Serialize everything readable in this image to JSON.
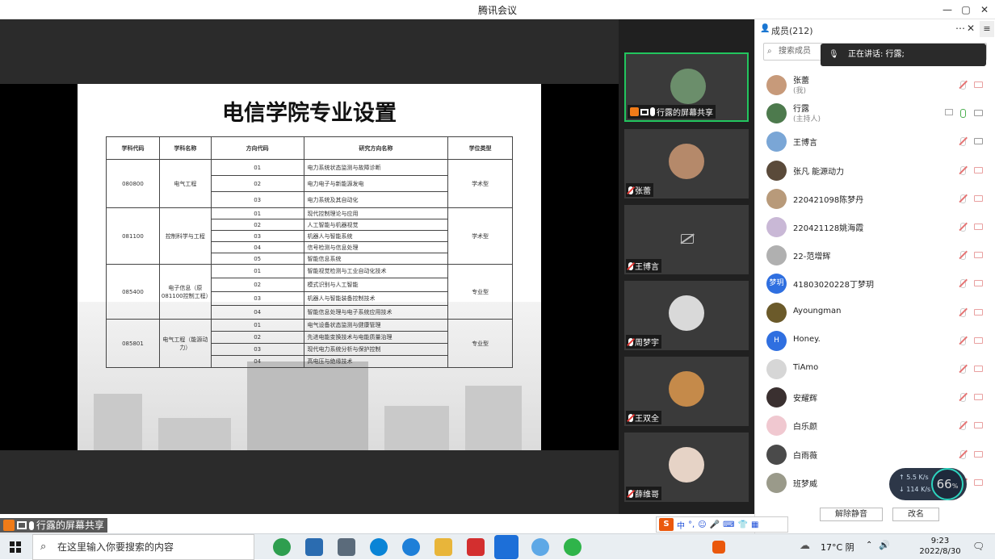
{
  "window": {
    "title": "腾讯会议"
  },
  "slide": {
    "title": "电信学院专业设置",
    "headers": [
      "学科代码",
      "学科名称",
      "方向代码",
      "研究方向名称",
      "学位类型"
    ],
    "groups": [
      {
        "code": "080800",
        "name": "电气工程",
        "degree": "学术型",
        "rows": [
          [
            "01",
            "电力系统状态监测与故障诊断"
          ],
          [
            "02",
            "电力电子与新能源发电"
          ],
          [
            "03",
            "电力系统及其自动化"
          ]
        ]
      },
      {
        "code": "081100",
        "name": "控制科学与工程",
        "degree": "学术型",
        "rows": [
          [
            "01",
            "现代控制理论与应用"
          ],
          [
            "02",
            "人工智能与机器视觉"
          ],
          [
            "03",
            "机器人与智能系统"
          ],
          [
            "04",
            "信号检测与信息处理"
          ],
          [
            "05",
            "智能信息系统"
          ]
        ]
      },
      {
        "code": "085400",
        "name": "电子信息（原081100控制工程）",
        "degree": "专业型",
        "rows": [
          [
            "01",
            "智能视觉检测与工业自动化技术"
          ],
          [
            "02",
            "模式识别与人工智能"
          ],
          [
            "03",
            "机器人与智能装备控制技术"
          ],
          [
            "04",
            "智能信息处理与电子系统应用技术"
          ]
        ]
      },
      {
        "code": "085801",
        "name": "电气工程（能源动力）",
        "degree": "专业型",
        "rows": [
          [
            "01",
            "电气设备状态监测与健康管理"
          ],
          [
            "02",
            "先进电能变换技术与电能质量治理"
          ],
          [
            "03",
            "现代电力系统分析与保护控制"
          ],
          [
            "04",
            "高电压与绝缘技术"
          ]
        ]
      }
    ]
  },
  "share_label": "行露的屏幕共享",
  "video_tiles": [
    {
      "label": "行露的屏幕共享",
      "color": "#6b8e6b"
    },
    {
      "label": "张蕾",
      "color": "#b5896a"
    },
    {
      "label": "王博言",
      "color": ""
    },
    {
      "label": "周梦宇",
      "color": "#d9d9d9"
    },
    {
      "label": "王双全",
      "color": "#c58a4a"
    },
    {
      "label": "薛维哥",
      "color": "#e6d3c6"
    }
  ],
  "panel": {
    "members_count": "成员(212)",
    "search_placeholder": "搜索成员",
    "speaking": "正在讲话: 行露;",
    "members": [
      {
        "name": "张蕾",
        "sub": "(我)",
        "color": "#c79a7a",
        "initial": ""
      },
      {
        "name": "行露",
        "sub": "(主持人)",
        "color": "#4d7a4d",
        "initial": ""
      },
      {
        "name": "王博言",
        "sub": "",
        "color": "#7aa6d6",
        "initial": ""
      },
      {
        "name": "张凡 能源动力",
        "sub": "",
        "color": "#5a4a3a",
        "initial": ""
      },
      {
        "name": "220421098陈梦丹",
        "sub": "",
        "color": "#b89a7a",
        "initial": ""
      },
      {
        "name": "220421128姚海霞",
        "sub": "",
        "color": "#c9b8d6",
        "initial": ""
      },
      {
        "name": "22-范增辉",
        "sub": "",
        "color": "#b0b0b0",
        "initial": ""
      },
      {
        "name": "41803020228丁梦玥",
        "sub": "",
        "color": "#2f6fe0",
        "initial": "梦玥"
      },
      {
        "name": "Ayoungman",
        "sub": "",
        "color": "#6b5a2a",
        "initial": ""
      },
      {
        "name": "Honey.",
        "sub": "",
        "color": "#2f6fe0",
        "initial": "H"
      },
      {
        "name": "TiAmo",
        "sub": "",
        "color": "#d6d6d6",
        "initial": ""
      },
      {
        "name": "安耀辉",
        "sub": "",
        "color": "#3a3030",
        "initial": ""
      },
      {
        "name": "白乐颜",
        "sub": "",
        "color": "#f0c8d0",
        "initial": ""
      },
      {
        "name": "白雨薇",
        "sub": "",
        "color": "#4a4a4a",
        "initial": ""
      },
      {
        "name": "班梦威",
        "sub": "",
        "color": "#9a9a8a",
        "initial": ""
      }
    ],
    "unmute_all": "解除静音",
    "rename": "改名"
  },
  "speed": {
    "up": "5.5",
    "down": "114",
    "unit": "K/s",
    "percent": "66"
  },
  "taskbar": {
    "search_placeholder": "在这里输入你要搜索的内容",
    "temp": "17°C 阴",
    "time": "9:23",
    "date": "2022/8/30"
  },
  "ime": {
    "mode": "中"
  }
}
